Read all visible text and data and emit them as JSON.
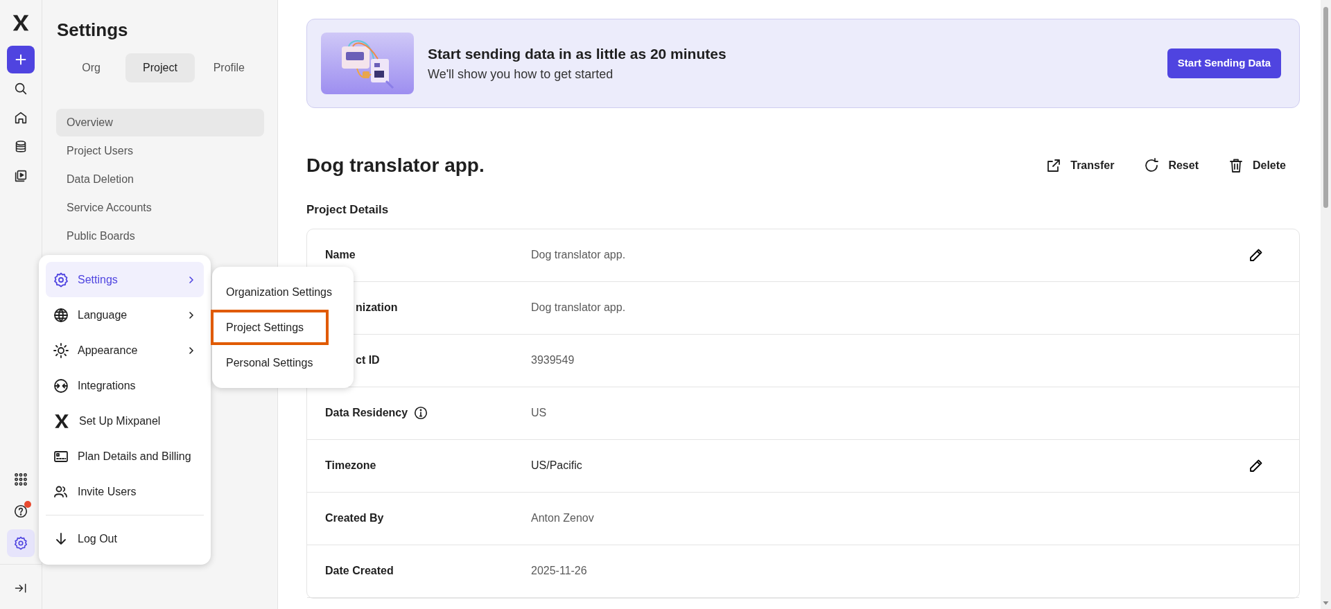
{
  "rail": {
    "top_items": [
      {
        "selected": false
      },
      {
        "selected": false
      },
      {
        "selected": false
      },
      {
        "selected": false
      }
    ],
    "bottom_items": [
      {
        "selected": false,
        "notification": false
      },
      {
        "selected": false,
        "notification": true
      },
      {
        "selected": true,
        "notification": false
      }
    ]
  },
  "sidebar": {
    "title": "Settings",
    "tabs": [
      {
        "label": "Org",
        "selected": false
      },
      {
        "label": "Project",
        "selected": true
      },
      {
        "label": "Profile",
        "selected": false
      }
    ],
    "items": [
      {
        "label": "Overview",
        "selected": true
      },
      {
        "label": "Project Users",
        "selected": false
      },
      {
        "label": "Data Deletion",
        "selected": false
      },
      {
        "label": "Service Accounts",
        "selected": false
      },
      {
        "label": "Public Boards",
        "selected": false
      }
    ]
  },
  "banner": {
    "title": "Start sending data in as little as 20 minutes",
    "subtitle": "We'll show you how to get started",
    "button": "Start Sending Data"
  },
  "project": {
    "title": "Dog translator app.",
    "actions": [
      "Transfer",
      "Reset",
      "Delete"
    ],
    "section": "Project Details",
    "rows": [
      {
        "label": "Name",
        "value": "Dog translator app.",
        "editable": true,
        "info": false,
        "emphasis": false,
        "clipped": false
      },
      {
        "label": "nization",
        "value": "Dog translator app.",
        "editable": false,
        "info": false,
        "emphasis": false,
        "clipped": true
      },
      {
        "label": "ct ID",
        "value": "3939549",
        "editable": false,
        "info": false,
        "emphasis": false,
        "clipped": true
      },
      {
        "label": "Data Residency",
        "value": "US",
        "editable": false,
        "info": true,
        "emphasis": false,
        "clipped": false
      },
      {
        "label": "Timezone",
        "value": "US/Pacific",
        "editable": true,
        "info": false,
        "emphasis": true,
        "clipped": false
      },
      {
        "label": "Created By",
        "value": "Anton Zenov",
        "editable": false,
        "info": false,
        "emphasis": false,
        "clipped": false
      },
      {
        "label": "Date Created",
        "value": "2025-11-26",
        "editable": false,
        "info": false,
        "emphasis": false,
        "clipped": false
      }
    ]
  },
  "menu": {
    "items": [
      {
        "label": "Settings",
        "selected": true,
        "has_submenu": true
      },
      {
        "label": "Language",
        "selected": false,
        "has_submenu": true
      },
      {
        "label": "Appearance",
        "selected": false,
        "has_submenu": true
      },
      {
        "label": "Integrations",
        "selected": false,
        "has_submenu": false
      },
      {
        "label": "Set Up Mixpanel",
        "selected": false,
        "has_submenu": false
      },
      {
        "label": "Plan Details and Billing",
        "selected": false,
        "has_submenu": false
      },
      {
        "label": "Invite Users",
        "selected": false,
        "has_submenu": false
      }
    ],
    "footer_items": [
      {
        "label": "Log Out",
        "selected": false,
        "has_submenu": false
      }
    ]
  },
  "submenu": {
    "items": [
      {
        "label": "Organization Settings",
        "highlighted": false
      },
      {
        "label": "Project Settings",
        "highlighted": true
      },
      {
        "label": "Personal Settings",
        "highlighted": false
      }
    ]
  }
}
